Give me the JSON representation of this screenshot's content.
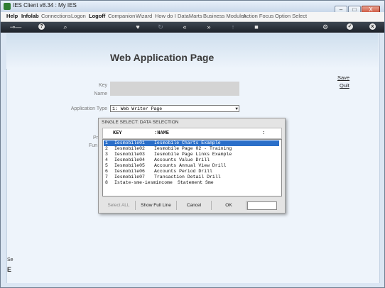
{
  "window": {
    "title": "IES Client v8.34 : My IES",
    "buttons": [
      "–",
      "□",
      "X"
    ]
  },
  "menubar": {
    "items": [
      "Help",
      "Infolab",
      "Connections",
      "Logon",
      "Logoff",
      "Companion",
      "Wizard",
      "How do I",
      "DataMarts",
      "Business Modules",
      "Action Focus",
      "Option Select"
    ]
  },
  "toolbar": {
    "icons": [
      "key-icon",
      "help-icon",
      "search-icon",
      "heart-icon",
      "refresh-icon",
      "back-icon",
      "forward-icon",
      "up-icon",
      "stop-icon",
      "settings-icon",
      "check-icon",
      "close-icon"
    ]
  },
  "page": {
    "title": "Web Application Page",
    "key_label": "Key",
    "name_label": "Name",
    "app_type_label": "Application Type",
    "app_type_value": "1: Web Writer Page",
    "save_link": "Save",
    "quit_link": "Quit",
    "partial_pr": "Pr",
    "partial_fun": "Fun",
    "left_partial_1": "Se",
    "left_partial_2": "E"
  },
  "dialog": {
    "title": "SINGLE SELECT: DATA SELECTION",
    "col_key": "KEY",
    "col_name": ":NAME",
    "col_end": ":",
    "rows": [
      {
        "n": "1",
        "key": "Iesmobile01",
        "name": "Iesmobile Charts Example"
      },
      {
        "n": "2",
        "key": "Iesmobile02",
        "name": "Iesmobile Page 02 - Training"
      },
      {
        "n": "3",
        "key": "Iesmobile03",
        "name": "Iesmobile Page Links Example"
      },
      {
        "n": "4",
        "key": "Iesmobile04",
        "name": "Accounts Value Drill"
      },
      {
        "n": "5",
        "key": "Iesmobile05",
        "name": "Accounts Annual View Drill"
      },
      {
        "n": "6",
        "key": "Iesmobile06",
        "name": "Accounts Period Drill"
      },
      {
        "n": "7",
        "key": "Iesmobile07",
        "name": "Transaction Detail Drill"
      },
      {
        "n": "8",
        "key": "Istate-sme-iesmincome",
        "name": "Statement Sme"
      }
    ],
    "btn_select_all": "Select ALL",
    "btn_full_line": "Show Full Line",
    "btn_cancel": "Cancel",
    "btn_ok": "OK"
  },
  "colors": {
    "selection": "#2b6fc9",
    "toolbar": "#2a3038",
    "background": "#eef4fb"
  }
}
